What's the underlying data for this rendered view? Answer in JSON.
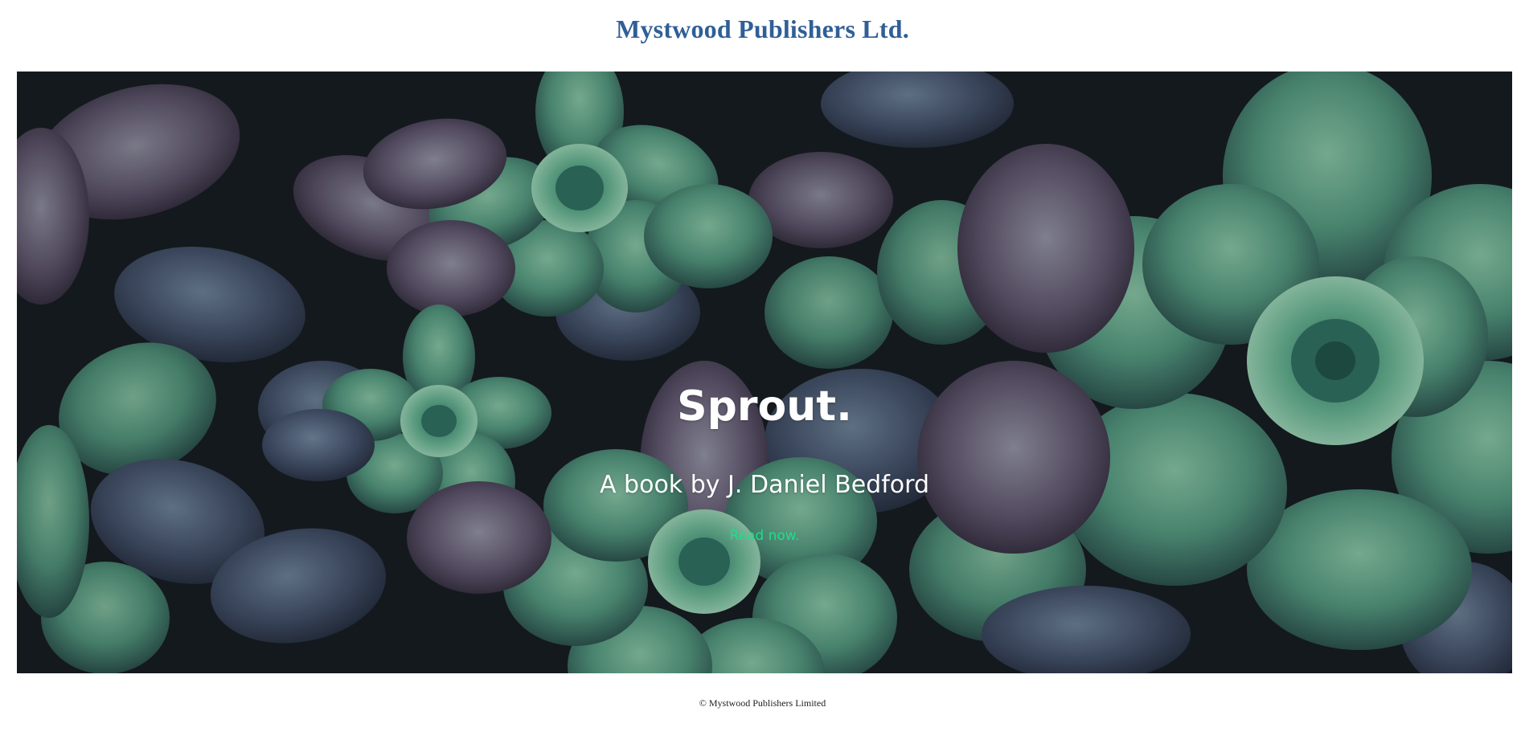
{
  "header": {
    "title": "Mystwood Publishers Ltd."
  },
  "hero": {
    "image_subject": "succulent-plants-photo",
    "title": "Sprout.",
    "subtitle": "A book by J. Daniel Bedford",
    "link_label": "Read now."
  },
  "footer": {
    "text": "© Mystwood Publishers Limited"
  },
  "colors": {
    "title": "#2f5f96",
    "link": "#19e08a",
    "hero_text": "#ffffff"
  }
}
